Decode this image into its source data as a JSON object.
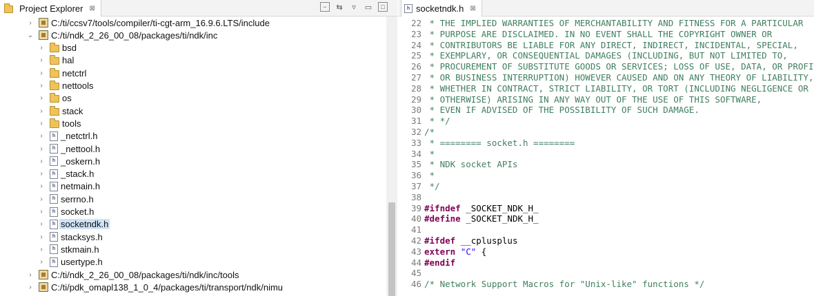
{
  "project_explorer": {
    "tab_title": "Project Explorer",
    "tab_close": "⊠",
    "tree": [
      {
        "level": 0,
        "expanded": false,
        "icon": "library",
        "label": "C:/ti/ccsv7/tools/compiler/ti-cgt-arm_16.9.6.LTS/include"
      },
      {
        "level": 0,
        "expanded": true,
        "icon": "library",
        "label": "C:/ti/ndk_2_26_00_08/packages/ti/ndk/inc"
      },
      {
        "level": 1,
        "expanded": false,
        "icon": "folder",
        "label": "bsd"
      },
      {
        "level": 1,
        "expanded": false,
        "icon": "folder",
        "label": "hal"
      },
      {
        "level": 1,
        "expanded": false,
        "icon": "folder",
        "label": "netctrl"
      },
      {
        "level": 1,
        "expanded": false,
        "icon": "folder",
        "label": "nettools"
      },
      {
        "level": 1,
        "expanded": false,
        "icon": "folder",
        "label": "os"
      },
      {
        "level": 1,
        "expanded": false,
        "icon": "folder",
        "label": "stack"
      },
      {
        "level": 1,
        "expanded": false,
        "icon": "folder",
        "label": "tools"
      },
      {
        "level": 1,
        "expanded": false,
        "icon": "hfile",
        "label": "_netctrl.h"
      },
      {
        "level": 1,
        "expanded": false,
        "icon": "hfile",
        "label": "_nettool.h"
      },
      {
        "level": 1,
        "expanded": false,
        "icon": "hfile",
        "label": "_oskern.h"
      },
      {
        "level": 1,
        "expanded": false,
        "icon": "hfile",
        "label": "_stack.h"
      },
      {
        "level": 1,
        "expanded": false,
        "icon": "hfile",
        "label": "netmain.h"
      },
      {
        "level": 1,
        "expanded": false,
        "icon": "hfile",
        "label": "serrno.h"
      },
      {
        "level": 1,
        "expanded": false,
        "icon": "hfile",
        "label": "socket.h"
      },
      {
        "level": 1,
        "expanded": false,
        "icon": "hfile",
        "label": "socketndk.h",
        "selected": true
      },
      {
        "level": 1,
        "expanded": false,
        "icon": "hfile",
        "label": "stacksys.h"
      },
      {
        "level": 1,
        "expanded": false,
        "icon": "hfile",
        "label": "stkmain.h"
      },
      {
        "level": 1,
        "expanded": false,
        "icon": "hfile",
        "label": "usertype.h"
      },
      {
        "level": 0,
        "expanded": false,
        "icon": "library",
        "label": "C:/ti/ndk_2_26_00_08/packages/ti/ndk/inc/tools"
      },
      {
        "level": 0,
        "expanded": false,
        "icon": "library",
        "label": "C:/ti/pdk_omapl138_1_0_4/packages/ti/transport/ndk/nimu"
      }
    ]
  },
  "editor": {
    "tab_title": "socketndk.h",
    "tab_close": "⊠",
    "lines": [
      {
        "n": "22",
        "parts": [
          {
            "c": "cm",
            "t": " * THE IMPLIED WARRANTIES OF MERCHANTABILITY AND FITNESS FOR A PARTICULAR"
          }
        ]
      },
      {
        "n": "23",
        "parts": [
          {
            "c": "cm",
            "t": " * PURPOSE ARE DISCLAIMED. IN NO EVENT SHALL THE COPYRIGHT OWNER OR"
          }
        ]
      },
      {
        "n": "24",
        "parts": [
          {
            "c": "cm",
            "t": " * CONTRIBUTORS BE LIABLE FOR ANY DIRECT, INDIRECT, INCIDENTAL, SPECIAL,"
          }
        ]
      },
      {
        "n": "25",
        "parts": [
          {
            "c": "cm",
            "t": " * EXEMPLARY, OR CONSEQUENTIAL DAMAGES (INCLUDING, BUT NOT LIMITED TO,"
          }
        ]
      },
      {
        "n": "26",
        "parts": [
          {
            "c": "cm",
            "t": " * PROCUREMENT OF SUBSTITUTE GOODS OR SERVICES; LOSS OF USE, DATA, OR PROFITS;"
          }
        ]
      },
      {
        "n": "27",
        "parts": [
          {
            "c": "cm",
            "t": " * OR BUSINESS INTERRUPTION) HOWEVER CAUSED AND ON ANY THEORY OF LIABILITY,"
          }
        ]
      },
      {
        "n": "28",
        "parts": [
          {
            "c": "cm",
            "t": " * WHETHER IN CONTRACT, STRICT LIABILITY, OR TORT (INCLUDING NEGLIGENCE OR"
          }
        ]
      },
      {
        "n": "29",
        "parts": [
          {
            "c": "cm",
            "t": " * OTHERWISE) ARISING IN ANY WAY OUT OF THE USE OF THIS SOFTWARE,"
          }
        ]
      },
      {
        "n": "30",
        "parts": [
          {
            "c": "cm",
            "t": " * EVEN IF ADVISED OF THE POSSIBILITY OF SUCH DAMAGE."
          }
        ]
      },
      {
        "n": "31",
        "parts": [
          {
            "c": "cm",
            "t": " * */"
          }
        ]
      },
      {
        "n": "32",
        "parts": [
          {
            "c": "cm",
            "t": "/*"
          }
        ]
      },
      {
        "n": "33",
        "parts": [
          {
            "c": "cm",
            "t": " * ======== socket.h ========"
          }
        ]
      },
      {
        "n": "34",
        "parts": [
          {
            "c": "cm",
            "t": " *"
          }
        ]
      },
      {
        "n": "35",
        "parts": [
          {
            "c": "cm",
            "t": " * NDK socket APIs"
          }
        ]
      },
      {
        "n": "36",
        "parts": [
          {
            "c": "cm",
            "t": " *"
          }
        ]
      },
      {
        "n": "37",
        "parts": [
          {
            "c": "cm",
            "t": " */"
          }
        ]
      },
      {
        "n": "38",
        "parts": []
      },
      {
        "n": "39",
        "parts": [
          {
            "c": "kw",
            "t": "#ifndef"
          },
          {
            "c": "pl",
            "t": " _SOCKET_NDK_H_"
          }
        ]
      },
      {
        "n": "40",
        "parts": [
          {
            "c": "kw",
            "t": "#define"
          },
          {
            "c": "pl",
            "t": " _SOCKET_NDK_H_"
          }
        ]
      },
      {
        "n": "41",
        "parts": []
      },
      {
        "n": "42",
        "parts": [
          {
            "c": "kw",
            "t": "#ifdef"
          },
          {
            "c": "pl",
            "t": " __cplusplus"
          }
        ]
      },
      {
        "n": "43",
        "parts": [
          {
            "c": "kw",
            "t": "extern"
          },
          {
            "c": "pl",
            "t": " "
          },
          {
            "c": "str",
            "t": "\"C\""
          },
          {
            "c": "pl",
            "t": " {"
          }
        ]
      },
      {
        "n": "44",
        "parts": [
          {
            "c": "kw",
            "t": "#endif"
          }
        ]
      },
      {
        "n": "45",
        "parts": []
      },
      {
        "n": "46",
        "parts": [
          {
            "c": "cm",
            "t": "/* Network Support Macros for \"Unix-like\" functions */"
          }
        ]
      }
    ]
  }
}
